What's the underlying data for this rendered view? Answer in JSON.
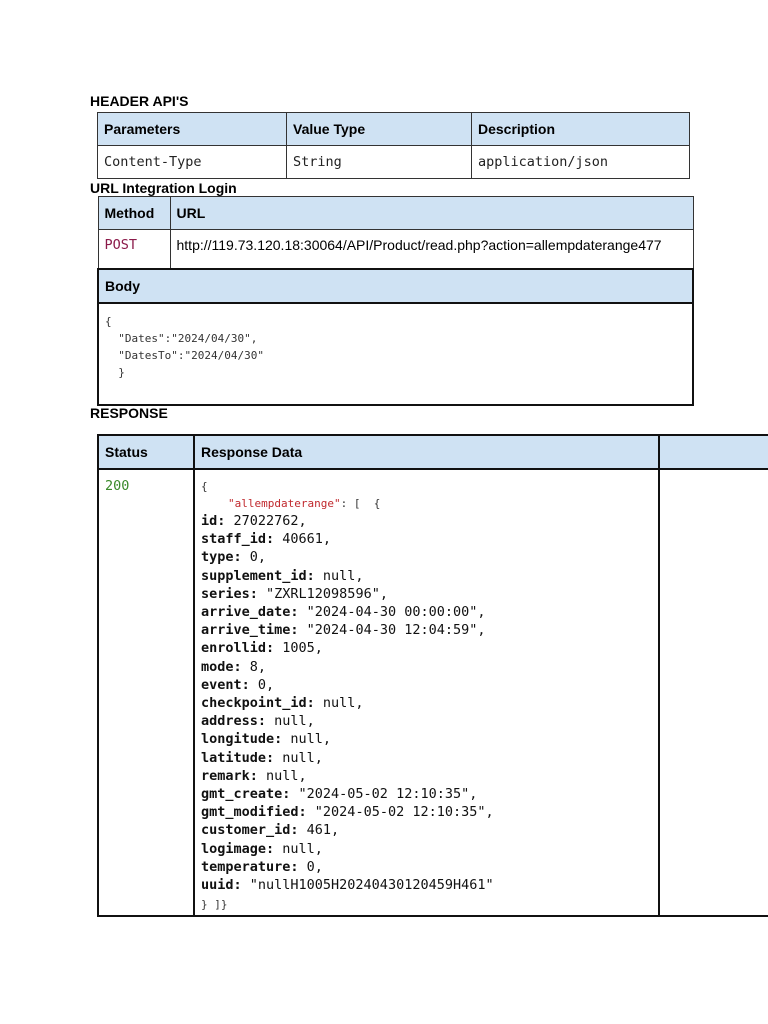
{
  "sections": {
    "header": "HEADER API'S",
    "url": "URL Integration Login",
    "response": "RESPONSE"
  },
  "header_table": {
    "columns": [
      "Parameters",
      "Value Type",
      "Description"
    ],
    "row": [
      "Content-Type",
      "String",
      "application/json"
    ]
  },
  "url_table": {
    "columns": [
      "Method",
      "URL"
    ],
    "method": "POST",
    "url": "http://119.73.120.18:30064/API/Product/read.php?action=allempdaterange477",
    "body_label": "Body",
    "body": "{\n  \"Dates\":\"2024/04/30\",\n  \"DatesTo\":\"2024/04/30\"\n  }"
  },
  "response_table": {
    "columns": [
      "Status",
      "Response Data",
      ""
    ],
    "status": "200",
    "open": "{",
    "array_key": "\"allempdaterange\"",
    "array_open": ": [  {",
    "close": "} ]}",
    "fields": [
      {
        "k": "id:",
        "v": " 27022762,"
      },
      {
        "k": "staff_id:",
        "v": " 40661,"
      },
      {
        "k": "type:",
        "v": " 0,"
      },
      {
        "k": "supplement_id:",
        "v": " null,"
      },
      {
        "k": "series:",
        "v": " \"ZXRL12098596\","
      },
      {
        "k": "arrive_date:",
        "v": " \"2024-04-30 00:00:00\","
      },
      {
        "k": "arrive_time:",
        "v": " \"2024-04-30 12:04:59\","
      },
      {
        "k": "enrollid:",
        "v": " 1005,"
      },
      {
        "k": "mode:",
        "v": " 8,"
      },
      {
        "k": "event:",
        "v": " 0,"
      },
      {
        "k": "checkpoint_id:",
        "v": " null,"
      },
      {
        "k": "address:",
        "v": " null,"
      },
      {
        "k": "longitude:",
        "v": " null,"
      },
      {
        "k": "latitude:",
        "v": " null,"
      },
      {
        "k": "remark:",
        "v": " null,"
      },
      {
        "k": "gmt_create:",
        "v": " \"2024-05-02 12:10:35\","
      },
      {
        "k": "gmt_modified:",
        "v": " \"2024-05-02 12:10:35\","
      },
      {
        "k": "customer_id:",
        "v": " 461,"
      },
      {
        "k": "logimage:",
        "v": " null,"
      },
      {
        "k": "temperature:",
        "v": " 0,"
      },
      {
        "k": "uuid:",
        "v": " \"nullH1005H20240430120459H461\""
      }
    ]
  },
  "colors": {
    "header_bg": "#cfe2f3",
    "post": "#8b1a4a",
    "status": "#3a8a2a",
    "key": "#c0282d"
  }
}
